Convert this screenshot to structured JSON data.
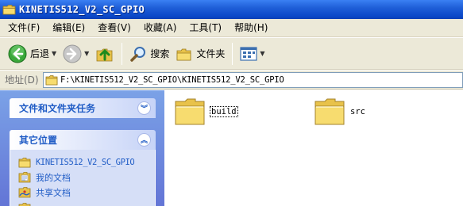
{
  "window": {
    "title": "KINETIS512_V2_SC_GPIO"
  },
  "menu": [
    "文件(F)",
    "编辑(E)",
    "查看(V)",
    "收藏(A)",
    "工具(T)",
    "帮助(H)"
  ],
  "toolbar": {
    "back_label": "后退",
    "search_label": "搜索",
    "folders_label": "文件夹"
  },
  "address": {
    "label": "地址(D)",
    "path": "F:\\KINETIS512_V2_SC_GPIO\\KINETIS512_V2_SC_GPIO"
  },
  "taskpane": {
    "file_tasks_title": "文件和文件夹任务",
    "other_places_title": "其它位置",
    "other_places": [
      "KINETIS512_V2_SC_GPIO",
      "我的文档",
      "共享文档"
    ]
  },
  "files": [
    {
      "name": "build",
      "icon": "folder-icon"
    },
    {
      "name": "src",
      "icon": "folder-icon"
    }
  ],
  "colors": {
    "title_bar": "#0b48c8",
    "task_pane": "#6375d6",
    "link": "#215dc6"
  }
}
